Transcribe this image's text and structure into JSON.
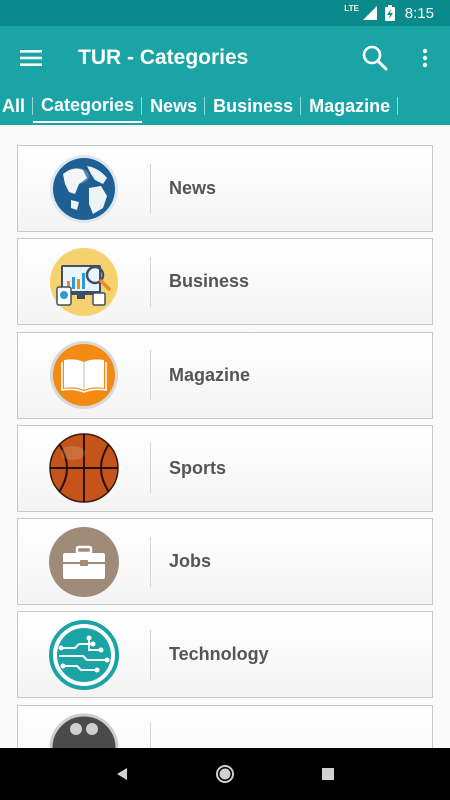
{
  "status_bar": {
    "network": "LTE",
    "time": "8:15"
  },
  "app_bar": {
    "title": "TUR - Categories",
    "menu_icon": "hamburger-menu-icon",
    "search_icon": "search-icon",
    "overflow_icon": "more-vert-icon"
  },
  "tabs": [
    {
      "label": "All",
      "active": false
    },
    {
      "label": "Categories",
      "active": true
    },
    {
      "label": "News",
      "active": false
    },
    {
      "label": "Business",
      "active": false
    },
    {
      "label": "Magazine",
      "active": false
    }
  ],
  "categories": [
    {
      "label": "News",
      "icon": "globe-icon"
    },
    {
      "label": "Business",
      "icon": "business-analytics-icon"
    },
    {
      "label": "Magazine",
      "icon": "open-book-icon"
    },
    {
      "label": "Sports",
      "icon": "basketball-icon"
    },
    {
      "label": "Jobs",
      "icon": "briefcase-icon"
    },
    {
      "label": "Technology",
      "icon": "circuit-board-icon"
    },
    {
      "label": "",
      "icon": "partial-category-icon"
    }
  ],
  "colors": {
    "status_bar": "#0b8a8c",
    "app_bar": "#1aa4a6",
    "nav_bar": "#000000"
  }
}
